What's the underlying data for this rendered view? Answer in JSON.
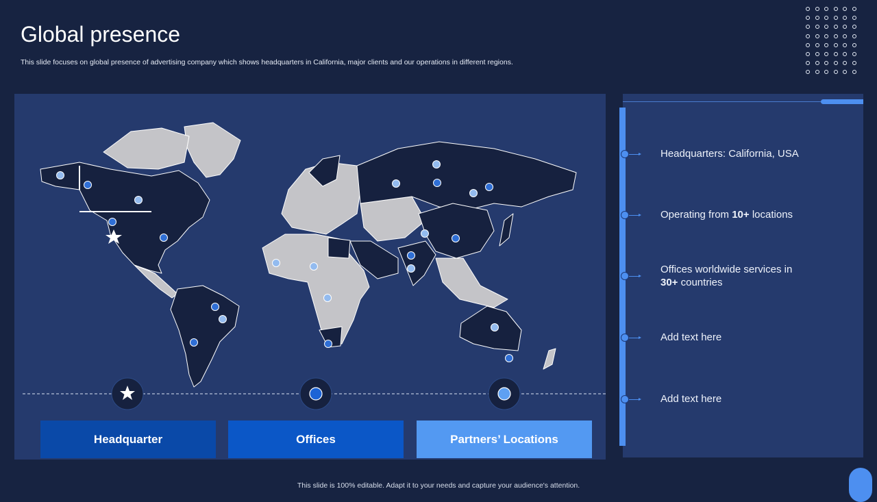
{
  "header": {
    "title": "Global presence",
    "subtitle": "This slide focuses on global presence of advertising company which shows headquarters in California, major clients and our operations in different regions."
  },
  "legend": {
    "headquarter": "Headquarter",
    "offices": "Offices",
    "partners": "Partners’ Locations"
  },
  "colors": {
    "headquarter": "#0a49a8",
    "offices": "#0b57c7",
    "partners": "#5399f2",
    "office_marker": "#2f6fd6",
    "partner_marker": "#93bbef"
  },
  "info": {
    "items": [
      {
        "text": "Headquarters: California, USA"
      },
      {
        "pre": "Operating from ",
        "bold": "10+",
        "post": " locations"
      },
      {
        "pre": "Offices worldwide services in",
        "bold": "30+",
        "post": " countries"
      },
      {
        "text": "Add text here"
      },
      {
        "text": "Add text here"
      }
    ]
  },
  "footer": "This slide is 100% editable. Adapt it to your needs and capture your audience's attention."
}
